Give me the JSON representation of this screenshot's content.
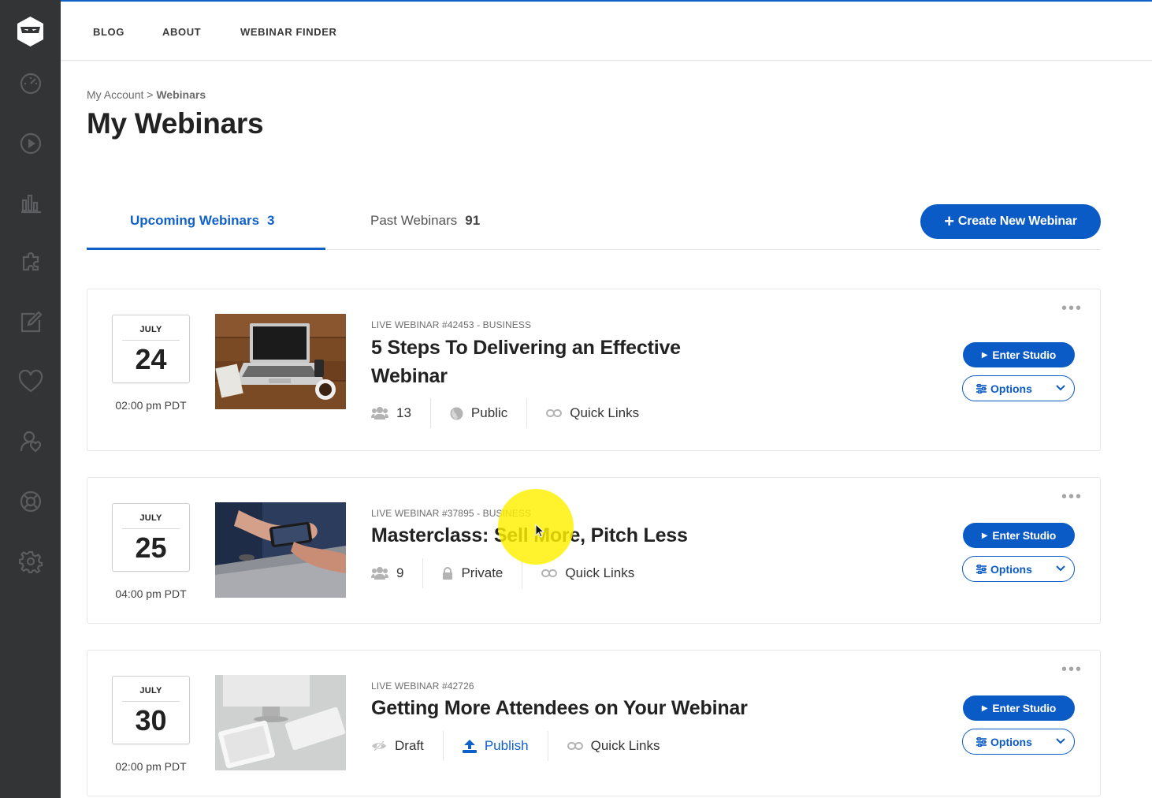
{
  "app": {
    "accent": "#1060c9",
    "sidebar_bg": "#333436"
  },
  "sidebar": {
    "logo": "ninja-logo",
    "items": [
      {
        "icon": "dashboard-gauge-icon"
      },
      {
        "icon": "play-circle-icon"
      },
      {
        "icon": "analytics-bar-chart-icon"
      },
      {
        "icon": "puzzle-integrations-icon"
      },
      {
        "icon": "edit-pencil-icon"
      },
      {
        "icon": "heart-icon"
      },
      {
        "icon": "user-heart-icon"
      },
      {
        "icon": "support-lifebuoy-icon"
      },
      {
        "icon": "settings-gear-icon"
      }
    ]
  },
  "topnav": {
    "blog": "BLOG",
    "about": "ABOUT",
    "finder": "WEBINAR FINDER"
  },
  "breadcrumb": {
    "parent": "My Account",
    "separator": ">",
    "current": "Webinars"
  },
  "page_title": "My Webinars",
  "tabs": {
    "upcoming": {
      "label": "Upcoming Webinars",
      "count": "3"
    },
    "past": {
      "label": "Past Webinars",
      "count": "91"
    }
  },
  "create_button": "Create New Webinar",
  "webinars": [
    {
      "month": "JULY",
      "day": "24",
      "time": "02:00 pm PDT",
      "meta": "LIVE WEBINAR #42453 - BUSINESS",
      "title_line1": "5 Steps To Delivering an Effective",
      "title_line2": "Webinar",
      "attendees": "13",
      "visibility": "Public",
      "quick_links": "Quick Links",
      "enter": "Enter Studio",
      "options": "Options"
    },
    {
      "month": "JULY",
      "day": "25",
      "time": "04:00 pm PDT",
      "meta": "LIVE WEBINAR #37895 - BUSINESS",
      "title": "Masterclass: Sell More, Pitch Less",
      "attendees": "9",
      "visibility": "Private",
      "quick_links": "Quick Links",
      "enter": "Enter Studio",
      "options": "Options"
    },
    {
      "month": "JULY",
      "day": "30",
      "time": "02:00 pm PDT",
      "meta": "LIVE WEBINAR #42726",
      "title": "Getting More Attendees on Your Webinar",
      "status": "Draft",
      "publish": "Publish",
      "quick_links": "Quick Links",
      "enter": "Enter Studio",
      "options": "Options"
    }
  ]
}
